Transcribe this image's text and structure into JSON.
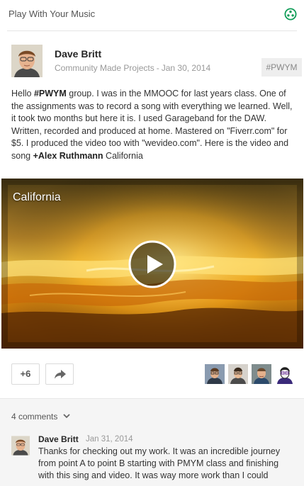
{
  "community": {
    "name": "Play With Your Music",
    "icon": "community-icon",
    "icon_color": "#0f9d58"
  },
  "post": {
    "author": "Dave Britt",
    "category": "Community Made Projects",
    "separator": "-",
    "date": "Jan 30, 2014",
    "hashtag_chip": "#PWYM",
    "body": {
      "t1": "Hello ",
      "b1": "#PWYM",
      "t2": " group.  I was in the MMOOC for last years class.  One of the assignments was to record a song with everything we learned.  Well, it took two months but here it is.  I used Garageband for the DAW.  Written, recorded and produced at home.  Mastered on \"Fiverr.com\" for $5.  I produced  the video too with \"wevideo.com\".  Here is the video and song ",
      "b2": "+Alex Ruthmann",
      "t3": " California"
    }
  },
  "video": {
    "title": "California",
    "play_icon": "play-icon"
  },
  "actions": {
    "plus_label": "+6",
    "share_icon": "share-arrow-icon",
    "plussers": [
      "plusser-1",
      "plusser-2",
      "plusser-3",
      "plusser-4"
    ]
  },
  "comments": {
    "count_label": "4 comments",
    "toggle_icon": "chevron-down-icon",
    "items": [
      {
        "author": "Dave Britt",
        "date": "Jan 31, 2014",
        "text": "Thanks for checking out my work. It was an incredible journey from point A to point B starting with PMYM class and finishing with this sing and video. It was way more work than I could"
      }
    ]
  },
  "colors": {
    "accent_green": "#0f9d58",
    "chip_bg": "#eeeeee",
    "comments_bg": "#f5f5f5"
  }
}
